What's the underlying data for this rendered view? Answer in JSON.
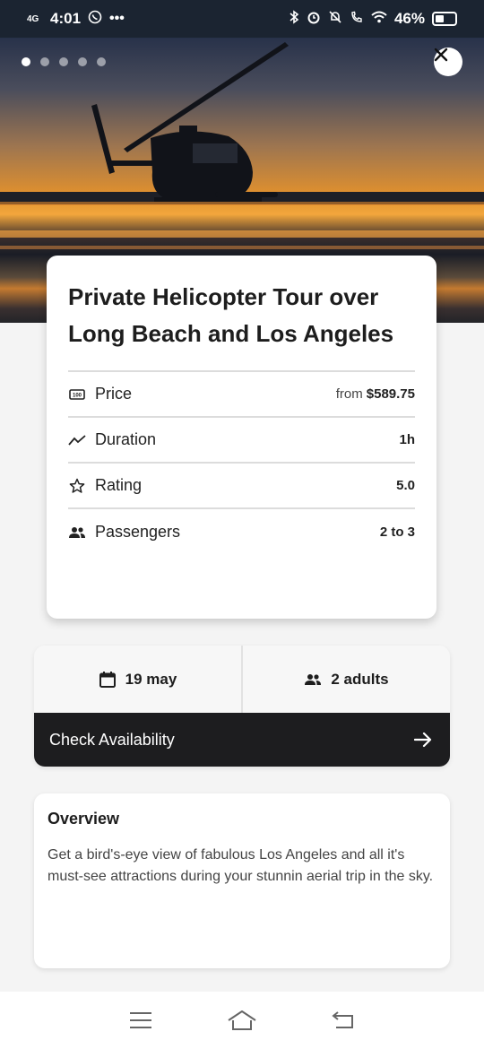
{
  "status_bar": {
    "network": "4G",
    "time": "4:01",
    "battery": "46%",
    "battery_level": 0.46
  },
  "hero": {
    "slide_count": 5,
    "active_slide": 1
  },
  "tour": {
    "title": "Private Helicopter Tour over Long Beach and Los Angeles",
    "details": [
      {
        "icon": "price-icon",
        "label": "Price",
        "prefix": "from",
        "value": "$589.75"
      },
      {
        "icon": "duration-icon",
        "label": "Duration",
        "prefix": "",
        "value": "1h"
      },
      {
        "icon": "star-icon",
        "label": "Rating",
        "prefix": "",
        "value": "5.0"
      },
      {
        "icon": "people-icon",
        "label": "Passengers",
        "prefix": "",
        "value": "2 to 3"
      }
    ]
  },
  "booking": {
    "date": "19 may",
    "guests": "2 adults",
    "check_label": "Check Availability"
  },
  "overview": {
    "heading": "Overview",
    "text": "Get a bird's-eye view of fabulous Los Angeles and all it's must-see attractions during your stunnin aerial trip in the sky."
  },
  "colors": {
    "accent_dark": "#1d1d1f",
    "status_bar_bg": "#1b2431"
  }
}
